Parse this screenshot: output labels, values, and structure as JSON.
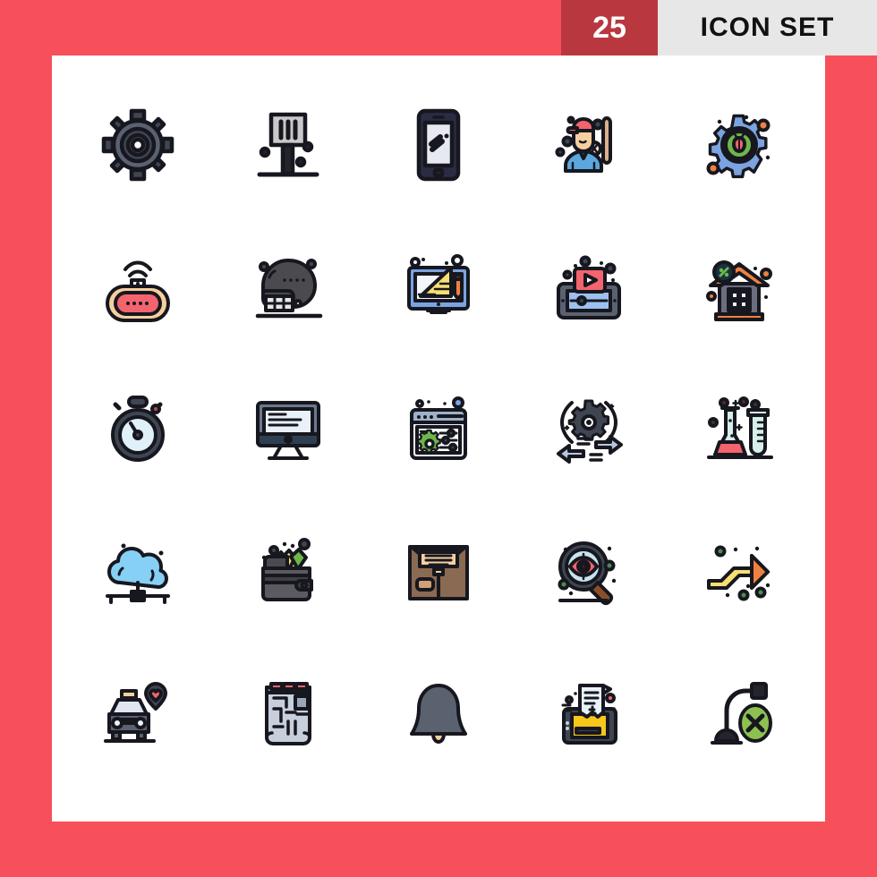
{
  "header": {
    "count": "25",
    "title": "ICON SET"
  },
  "colors": {
    "background": "#f7505a",
    "count_box": "#b9383f",
    "title_box": "#e7e7e7",
    "canvas": "#ffffff",
    "outline": "#17171f",
    "accent_blue": "#7ba3e0",
    "accent_lightblue": "#86d0f5",
    "accent_red": "#f2646e",
    "accent_yellow": "#f7df72",
    "accent_orange": "#ef8140",
    "accent_green": "#6fb64a",
    "accent_tan": "#f5cfa0",
    "accent_gray": "#8d94a3",
    "accent_darkgray": "#3f4652"
  },
  "grid": {
    "columns": 5,
    "rows": 5,
    "total": 25
  },
  "icons": [
    {
      "row": 1,
      "col": 1,
      "name": "gear-icon",
      "label": "Settings Gear"
    },
    {
      "row": 1,
      "col": 2,
      "name": "spatula-icon",
      "label": "Spatula"
    },
    {
      "row": 1,
      "col": 3,
      "name": "smartphone-icon",
      "label": "Smartphone"
    },
    {
      "row": 1,
      "col": 4,
      "name": "baseball-player-icon",
      "label": "Baseball Player"
    },
    {
      "row": 1,
      "col": 5,
      "name": "bug-gear-icon",
      "label": "Debug Gear"
    },
    {
      "row": 2,
      "col": 1,
      "name": "wifi-router-icon",
      "label": "Wireless Router"
    },
    {
      "row": 2,
      "col": 2,
      "name": "football-helmet-icon",
      "label": "Football Helmet"
    },
    {
      "row": 2,
      "col": 3,
      "name": "design-monitor-icon",
      "label": "Graphic Design Monitor"
    },
    {
      "row": 2,
      "col": 4,
      "name": "video-tablet-icon",
      "label": "Video Player Tablet"
    },
    {
      "row": 2,
      "col": 5,
      "name": "house-discount-icon",
      "label": "House Discount"
    },
    {
      "row": 3,
      "col": 1,
      "name": "stopwatch-icon",
      "label": "Stopwatch"
    },
    {
      "row": 3,
      "col": 2,
      "name": "desktop-monitor-icon",
      "label": "Desktop Monitor"
    },
    {
      "row": 3,
      "col": 3,
      "name": "browser-settings-icon",
      "label": "Browser Settings"
    },
    {
      "row": 3,
      "col": 4,
      "name": "transfer-gear-icon",
      "label": "Transfer Settings"
    },
    {
      "row": 3,
      "col": 5,
      "name": "lab-flask-icon",
      "label": "Lab Flask and Test Tube"
    },
    {
      "row": 4,
      "col": 1,
      "name": "cloud-network-icon",
      "label": "Cloud Network"
    },
    {
      "row": 4,
      "col": 2,
      "name": "wallet-icon",
      "label": "Wallet with Cards"
    },
    {
      "row": 4,
      "col": 3,
      "name": "package-box-icon",
      "label": "Package Box"
    },
    {
      "row": 4,
      "col": 4,
      "name": "eye-search-icon",
      "label": "Surveillance Search"
    },
    {
      "row": 4,
      "col": 5,
      "name": "growth-arrow-icon",
      "label": "Growth Arrow"
    },
    {
      "row": 5,
      "col": 1,
      "name": "taxi-favorite-icon",
      "label": "Favorite Taxi"
    },
    {
      "row": 5,
      "col": 2,
      "name": "floor-plan-icon",
      "label": "Floor Plan"
    },
    {
      "row": 5,
      "col": 3,
      "name": "notification-bell-icon",
      "label": "Notification Bell"
    },
    {
      "row": 5,
      "col": 4,
      "name": "invoice-tablet-icon",
      "label": "Mobile Invoice"
    },
    {
      "row": 5,
      "col": 5,
      "name": "lamp-disabled-icon",
      "label": "Lamp Disabled"
    }
  ]
}
